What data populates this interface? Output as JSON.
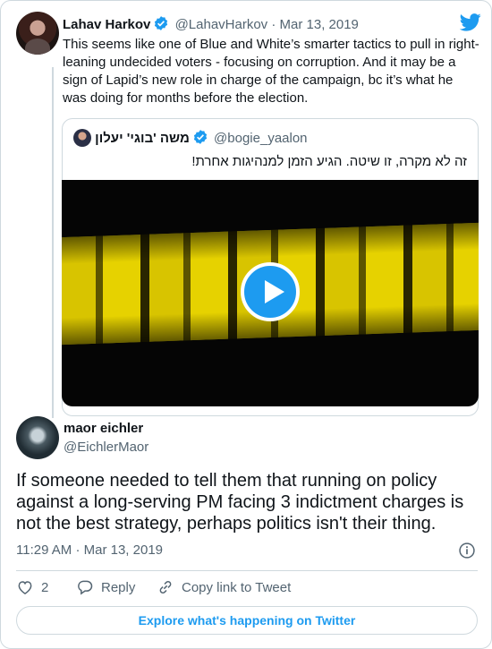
{
  "parent_tweet": {
    "author_name": "Lahav Harkov",
    "author_handle": "@LahavHarkov",
    "separator": "·",
    "date": "Mar 13, 2019",
    "text": "This seems like one of Blue and White’s smarter tactics to pull in right-leaning undecided voters - focusing on corruption. And it may be a sign of Lapid’s new role in charge of the campaign, bc it’s what he was doing for months before the election.",
    "quoted": {
      "author_name": "משה 'בוגי' יעלון",
      "author_handle": "@bogie_yaalon",
      "text": "זה לא מקרה, זו שיטה. הגיע הזמן למנהיגות אחרת!",
      "media": {
        "type": "video",
        "icon": "play-icon"
      }
    }
  },
  "main_tweet": {
    "author_name": "maor eichler",
    "author_handle": "@EichlerMaor",
    "text": "If someone needed to tell them that running on policy against a long-serving PM facing 3 indictment charges is not the best strategy, perhaps politics isn't their thing.",
    "time": "11:29 AM",
    "separator": "·",
    "date": "Mar 13, 2019"
  },
  "actions": {
    "like_count": "2",
    "reply_label": "Reply",
    "copy_link_label": "Copy link to Tweet"
  },
  "explore_label": "Explore what's happening on Twitter",
  "colors": {
    "brand": "#1d9bf0",
    "text": "#0f1419",
    "muted": "#536471",
    "border": "#cfd9de"
  }
}
